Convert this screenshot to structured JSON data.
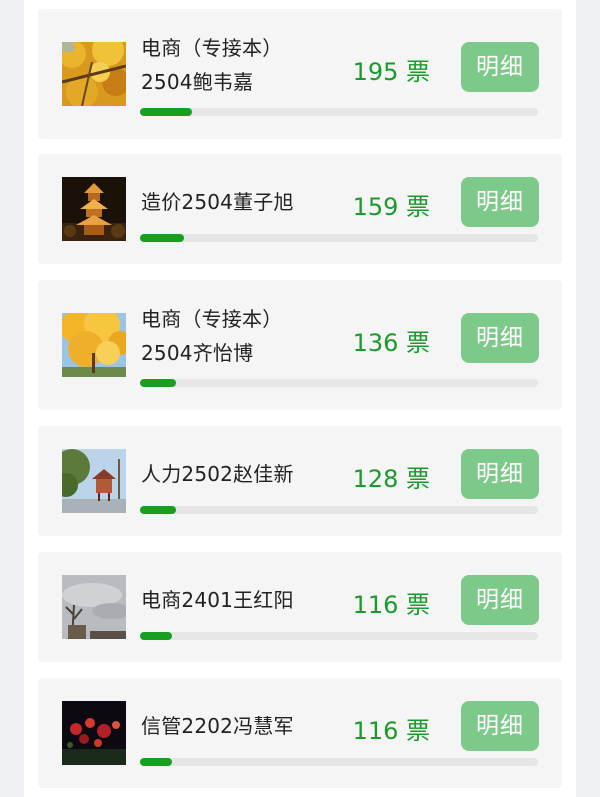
{
  "accent": "#17a01f",
  "button_color": "#7cc98a",
  "items": [
    {
      "name": "电商（专接本）2504鲍韦嘉",
      "votes": "195 票",
      "vote_count": 195,
      "detail_label": "明细",
      "progress": 0.13,
      "photo_icon": "autumn-leaves-photo"
    },
    {
      "name": "造价2504董子旭",
      "votes": "159 票",
      "vote_count": 159,
      "detail_label": "明细",
      "progress": 0.11,
      "photo_icon": "night-pagoda-photo"
    },
    {
      "name": "电商（专接本）2504齐怡博",
      "votes": "136 票",
      "vote_count": 136,
      "detail_label": "明细",
      "progress": 0.09,
      "photo_icon": "yellow-tree-photo"
    },
    {
      "name": "人力2502赵佳新",
      "votes": "128 票",
      "vote_count": 128,
      "detail_label": "明细",
      "progress": 0.09,
      "photo_icon": "park-pavilion-photo"
    },
    {
      "name": "电商2401王红阳",
      "votes": "116 票",
      "vote_count": 116,
      "detail_label": "明细",
      "progress": 0.08,
      "photo_icon": "cloudy-sky-photo"
    },
    {
      "name": "信管2202冯慧军",
      "votes": "116 票",
      "vote_count": 116,
      "detail_label": "明细",
      "progress": 0.08,
      "photo_icon": "night-flowers-photo"
    }
  ]
}
